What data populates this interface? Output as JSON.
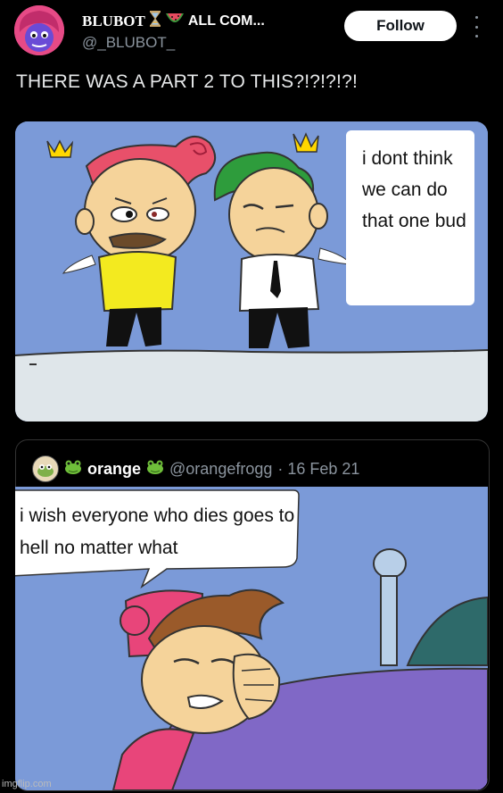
{
  "header": {
    "display_name": "BLUBOT",
    "display_name_suffix": "ALL COM...",
    "handle": "@_BLUBOT_",
    "follow_label": "Follow"
  },
  "tweet": {
    "text": "THERE WAS A PART 2 TO THIS?!?!?!?!"
  },
  "comic_top": {
    "speech": "i dont think we can do that one bud"
  },
  "quoted_tweet": {
    "name": "orange",
    "handle": "@orangefrogg",
    "date": "· 16 Feb 21",
    "speech": "i wish everyone who dies goes to hell no matter what"
  },
  "watermark": "imgflip.com",
  "colors": {
    "background": "#000000",
    "comic_sky": "#7b9ad8",
    "follow_bg": "#ffffff"
  }
}
